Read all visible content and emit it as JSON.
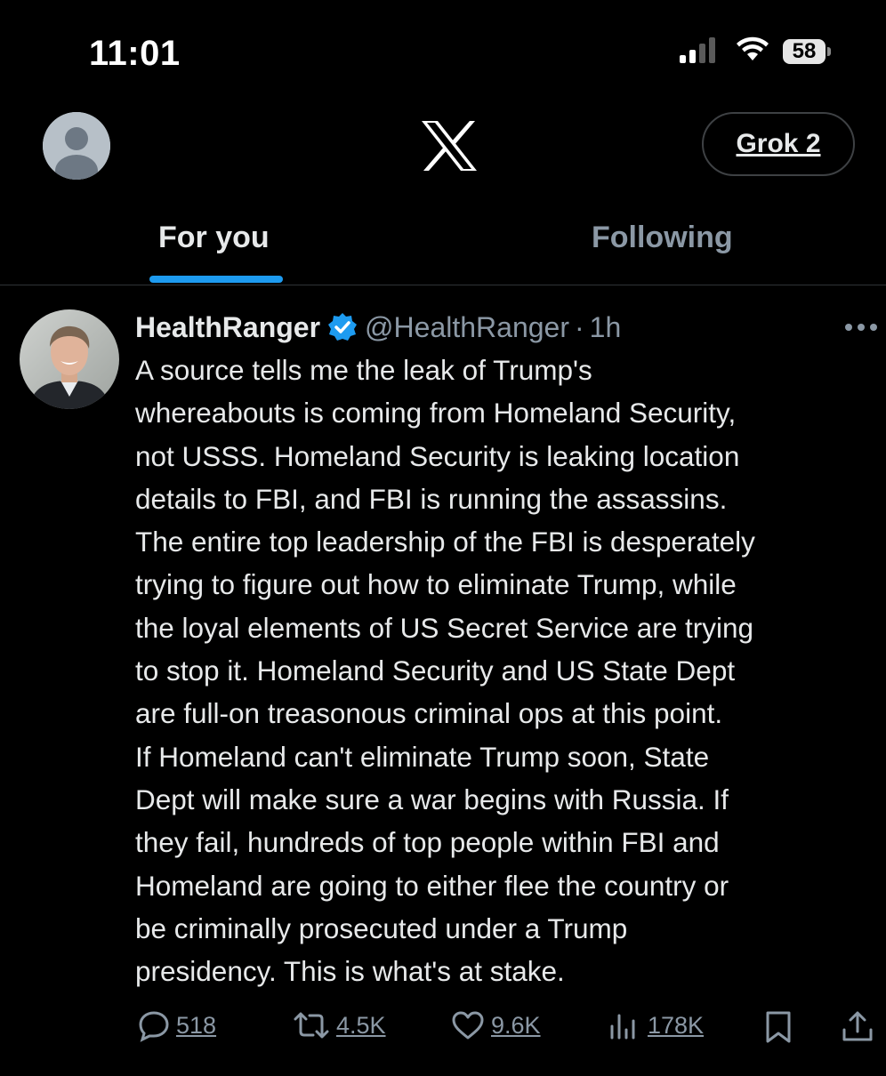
{
  "status_bar": {
    "time": "11:01",
    "battery": "58",
    "signal_icon": "cellular-signal-icon",
    "wifi_icon": "wifi-icon"
  },
  "header": {
    "logo": "x-logo",
    "grok_label": "Grok 2",
    "avatar_icon": "default-profile-avatar"
  },
  "tabs": [
    {
      "label": "For you",
      "active": true
    },
    {
      "label": "Following",
      "active": false
    }
  ],
  "tweet": {
    "display_name": "HealthRanger",
    "verified": true,
    "handle": "@HealthRanger",
    "separator": "·",
    "time": "1h",
    "text": "A source tells me the leak of Trump's\nwhereabouts is coming from Homeland Security,\nnot USSS. Homeland Security is leaking location\ndetails to FBI, and FBI is running the assassins.\nThe entire top leadership of the FBI is desperately\ntrying to figure out how to eliminate Trump, while\nthe loyal elements of US Secret Service are trying\nto stop it. Homeland Security and US State Dept\nare full-on treasonous criminal ops at this point.\nIf Homeland can't eliminate Trump soon, State\nDept will make sure a war begins with Russia. If\nthey fail, hundreds of top people within FBI and\nHomeland are going to either flee the country or\nbe criminally prosecuted under a Trump\npresidency. This is what's at stake.",
    "actions": {
      "replies": "518",
      "reposts": "4.5K",
      "likes": "9.6K",
      "views": "178K"
    }
  },
  "colors": {
    "background": "#000000",
    "text": "#e7e9ea",
    "muted": "#8b98a5",
    "accent": "#1d9bf0",
    "border": "#2f3336"
  }
}
